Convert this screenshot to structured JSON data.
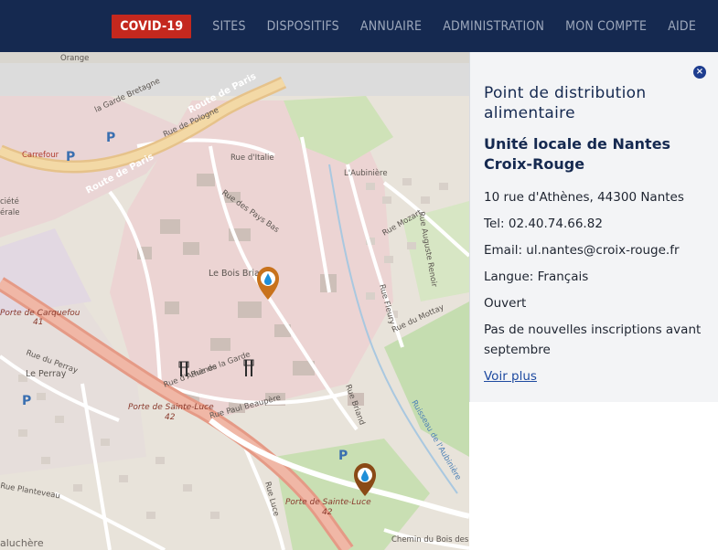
{
  "nav": {
    "covid": "COVID-19",
    "items": [
      "SITES",
      "DISPOSITIFS",
      "ANNUAIRE",
      "ADMINISTRATION",
      "MON COMPTE",
      "AIDE"
    ]
  },
  "map": {
    "labels": {
      "orange": "Orange",
      "la_garde_bretagne": "la Garde Bretagne",
      "route_paris": "Route de Paris",
      "route_paris2": "Route de Paris",
      "carrefour": "Carrefour",
      "route_polugne": "Rue de Pologne",
      "rue_italie": "Rue d'Italie",
      "aubiniere": "L'Aubinière",
      "pays_bas": "Rue des Pays Bas",
      "bois_briand": "Le Bois Briand",
      "porte_carquefou": "Porte de Carquefou",
      "porte_carquefou_num": "41",
      "perray": "Le Perray",
      "rue_perray": "Rue du Perray",
      "porte_sainte_luce": "Porte de Sainte-Luce",
      "porte_sainte_luce_num": "42",
      "porte_sainte_luce2": "Porte de Sainte-Luce",
      "porte_sainte_luce2_num": "42",
      "rue_paul_beaupere": "Rue Paul Beaupère",
      "rue_athenes": "Rue d'Athènes",
      "rue_la_garde": "Rue de la Garde",
      "rue_luce": "Rue Luce",
      "planteveau": "Rue Planteveau",
      "chemin_bois": "Chemin du Bois des Bois",
      "aluchere": "aluchère",
      "ciete": "ciété",
      "erale": "érale",
      "rue_mottay": "Rue du Mottay",
      "rue_mozart": "Rue Mozart",
      "auguste_renoir": "Rue Auguste Renoir",
      "ruisseau": "Ruisseau de l'Aubinière",
      "rue_fleury": "Rue Fleury",
      "rue_brand": "Rue Briand"
    },
    "icons": [
      "water-marker-icon",
      "restaurant-icon",
      "parking-icon"
    ]
  },
  "panel": {
    "category": "Point de distribution alimentaire",
    "name": "Unité locale de Nantes Croix-Rouge",
    "address": "10 rue d'Athènes, 44300 Nantes",
    "tel": "Tel: 02.40.74.66.82",
    "email": "Email: ul.nantes@croix-rouge.fr",
    "langue": "Langue: Français",
    "status": "Ouvert",
    "note": "Pas de nouvelles inscriptions avant septembre",
    "link": "Voir plus",
    "close_symbol": "×"
  },
  "colors": {
    "nav_bg": "#152950",
    "covid_bg": "#c4281e",
    "marker": "#c8721c"
  }
}
